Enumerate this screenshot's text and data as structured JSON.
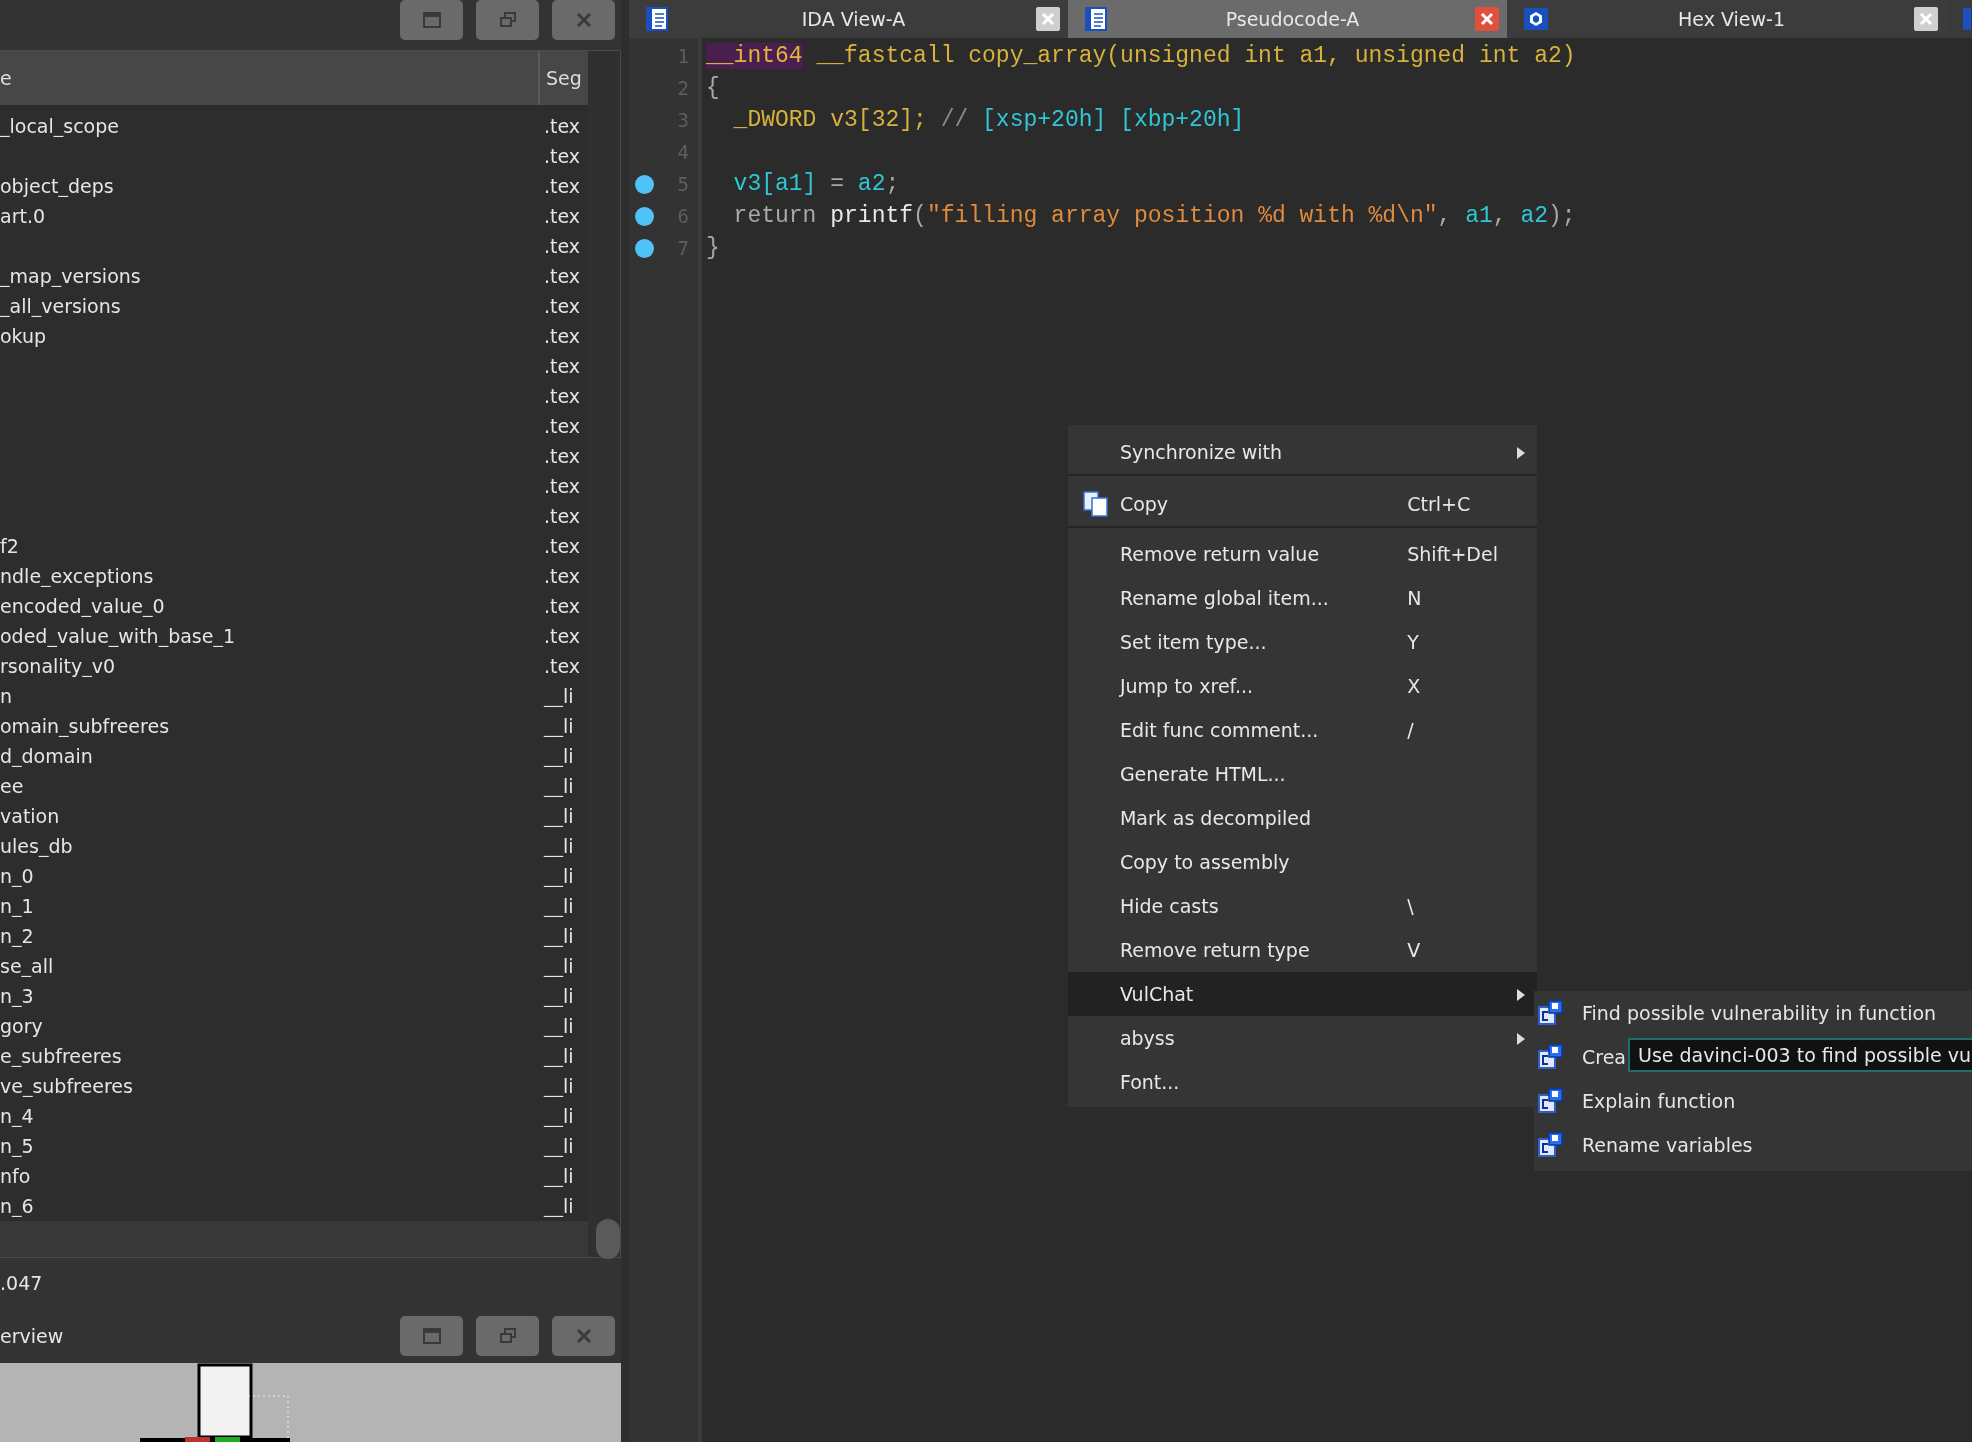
{
  "functions_panel": {
    "columns": [
      "e",
      "Seg"
    ],
    "rows": [
      {
        "name": "_local_scope",
        "segment": ".tex"
      },
      {
        "name": "",
        "segment": ".tex"
      },
      {
        "name": "object_deps",
        "segment": ".tex"
      },
      {
        "name": "art.0",
        "segment": ".tex"
      },
      {
        "name": "",
        "segment": ".tex"
      },
      {
        "name": "_map_versions",
        "segment": ".tex"
      },
      {
        "name": "_all_versions",
        "segment": ".tex"
      },
      {
        "name": "okup",
        "segment": ".tex"
      },
      {
        "name": "",
        "segment": ".tex"
      },
      {
        "name": "",
        "segment": ".tex"
      },
      {
        "name": "",
        "segment": ".tex"
      },
      {
        "name": "",
        "segment": ".tex"
      },
      {
        "name": "",
        "segment": ".tex"
      },
      {
        "name": "",
        "segment": ".tex"
      },
      {
        "name": "f2",
        "segment": ".tex"
      },
      {
        "name": "ndle_exceptions",
        "segment": ".tex"
      },
      {
        "name": "encoded_value_0",
        "segment": ".tex"
      },
      {
        "name": "oded_value_with_base_1",
        "segment": ".tex"
      },
      {
        "name": "rsonality_v0",
        "segment": ".tex"
      },
      {
        "name": "n",
        "segment": "__li"
      },
      {
        "name": "omain_subfreeres",
        "segment": "__li"
      },
      {
        "name": "d_domain",
        "segment": "__li"
      },
      {
        "name": "ee",
        "segment": "__li"
      },
      {
        "name": "vation",
        "segment": "__li"
      },
      {
        "name": "ules_db",
        "segment": "__li"
      },
      {
        "name": "n_0",
        "segment": "__li"
      },
      {
        "name": "n_1",
        "segment": "__li"
      },
      {
        "name": "n_2",
        "segment": "__li"
      },
      {
        "name": "se_all",
        "segment": "__li"
      },
      {
        "name": "n_3",
        "segment": "__li"
      },
      {
        "name": "gory",
        "segment": "__li"
      },
      {
        "name": "e_subfreeres",
        "segment": "__li"
      },
      {
        "name": "ve_subfreeres",
        "segment": "__li"
      },
      {
        "name": "n_4",
        "segment": "__li"
      },
      {
        "name": "n_5",
        "segment": "__li"
      },
      {
        "name": "nfo",
        "segment": "__li"
      },
      {
        "name": "n_6",
        "segment": "__li"
      }
    ],
    "status": ".047"
  },
  "overview_panel": {
    "title": "erview"
  },
  "tabs": [
    {
      "label": "IDA View-A",
      "kind": "listing",
      "selected": false
    },
    {
      "label": "Pseudocode-A",
      "kind": "listing",
      "selected": true
    },
    {
      "label": "Hex View-1",
      "kind": "hex",
      "selected": false
    }
  ],
  "code": [
    {
      "number": "1",
      "breakpoint": false,
      "tokens": [
        {
          "text": "__int64",
          "kind": "highlight"
        },
        {
          "text": " __fastcall copy_array(unsigned int a1, unsigned int a2)",
          "kind": "keyword"
        }
      ]
    },
    {
      "number": "2",
      "breakpoint": false,
      "tokens": [
        {
          "text": "{",
          "kind": "plain"
        }
      ]
    },
    {
      "number": "3",
      "breakpoint": false,
      "tokens": [
        {
          "text": "  _DWORD v3[32]; ",
          "kind": "keyword"
        },
        {
          "text": "// ",
          "kind": "comment"
        },
        {
          "text": "[xsp+20h] [xbp+20h]",
          "kind": "var"
        }
      ]
    },
    {
      "number": "4",
      "breakpoint": false
    },
    {
      "number": "5",
      "breakpoint": true,
      "tokens": [
        {
          "text": "  v3[a1]",
          "kind": "var"
        },
        {
          "text": " = ",
          "kind": "plain"
        },
        {
          "text": "a2",
          "kind": "var"
        },
        {
          "text": ";",
          "kind": "plain"
        }
      ]
    },
    {
      "number": "6",
      "breakpoint": true,
      "tokens": [
        {
          "text": "  return ",
          "kind": "plain"
        },
        {
          "text": "printf",
          "kind": "func"
        },
        {
          "text": "(",
          "kind": "plain"
        },
        {
          "text": "\"filling array position %d with %d\\n\"",
          "kind": "string"
        },
        {
          "text": ", ",
          "kind": "plain"
        },
        {
          "text": "a1",
          "kind": "var"
        },
        {
          "text": ", ",
          "kind": "plain"
        },
        {
          "text": "a2",
          "kind": "var"
        },
        {
          "text": ");",
          "kind": "plain"
        }
      ]
    },
    {
      "number": "7",
      "breakpoint": true,
      "tokens": [
        {
          "text": "}",
          "kind": "plain"
        }
      ]
    }
  ],
  "context_menu": [
    {
      "label": "Synchronize with",
      "submenu": true,
      "separator_after": true,
      "selected": false
    },
    {
      "label": "Copy",
      "shortcut": "Ctrl+C",
      "icon": true,
      "separator_after": true,
      "selected": false
    },
    {
      "label": "Remove return value",
      "shortcut": "Shift+Del",
      "selected": false
    },
    {
      "label": "Rename global item...",
      "shortcut": "N",
      "selected": false
    },
    {
      "label": "Set item type...",
      "shortcut": "Y",
      "selected": false
    },
    {
      "label": "Jump to xref...",
      "shortcut": "X",
      "selected": false
    },
    {
      "label": "Edit func comment...",
      "shortcut": "/",
      "selected": false
    },
    {
      "label": "Generate HTML...",
      "selected": false
    },
    {
      "label": "Mark as decompiled",
      "selected": false
    },
    {
      "label": "Copy to assembly",
      "selected": false
    },
    {
      "label": "Hide casts",
      "shortcut": "\\",
      "selected": false
    },
    {
      "label": "Remove return type",
      "shortcut": "V",
      "selected": false
    },
    {
      "label": "VulChat",
      "submenu": true,
      "selected": true
    },
    {
      "label": "abyss",
      "submenu": true,
      "selected": false
    },
    {
      "label": "Font...",
      "selected": false
    }
  ],
  "submenu": [
    {
      "label": "Find possible vulnerability in function"
    },
    {
      "label": "Crea"
    },
    {
      "label": "Explain function"
    },
    {
      "label": "Rename variables"
    }
  ],
  "tooltip": "Use davinci-003 to find possible vu"
}
